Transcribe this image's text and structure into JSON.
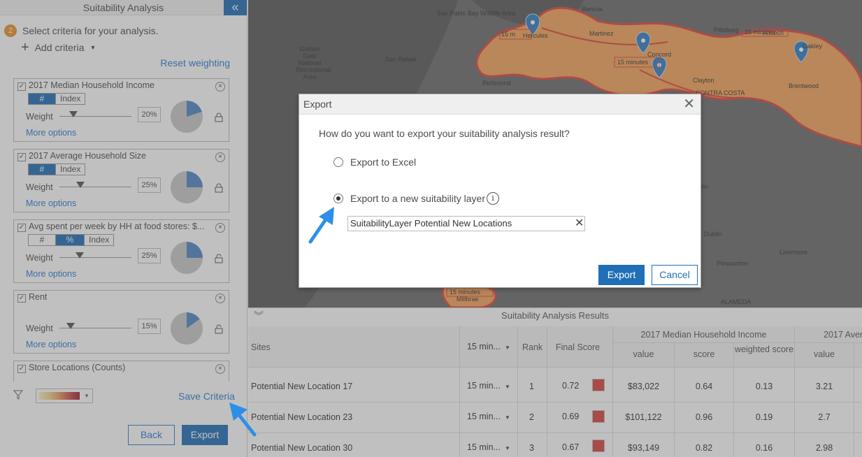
{
  "left_panel": {
    "title": "Suitability Analysis",
    "collapse_glyph": "«",
    "step_number": "2",
    "step_text": "Select criteria for your analysis.",
    "add_criteria": "Add criteria",
    "reset_weighting": "Reset weighting",
    "criteria": [
      {
        "title": "2017 Median Household Income",
        "seg": [
          "#",
          "Index"
        ],
        "active_seg": 0,
        "weight_label": "Weight",
        "weight": "20%",
        "weight_fraction": 0.2,
        "more": "More options",
        "locked": true
      },
      {
        "title": "2017 Average Household Size",
        "seg": [
          "#",
          "Index"
        ],
        "active_seg": 0,
        "weight_label": "Weight",
        "weight": "25%",
        "weight_fraction": 0.25,
        "more": "More options",
        "locked": true
      },
      {
        "title": "Avg spent per week by HH at food stores: $...",
        "seg": [
          "#",
          "%",
          "Index"
        ],
        "active_seg": 1,
        "weight_label": "Weight",
        "weight": "25%",
        "weight_fraction": 0.25,
        "more": "More options",
        "locked": false
      },
      {
        "title": "Rent",
        "seg": [],
        "active_seg": -1,
        "weight_label": "Weight",
        "weight": "15%",
        "weight_fraction": 0.15,
        "more": "More options",
        "locked": false
      },
      {
        "title": "Store Locations (Counts)"
      }
    ],
    "save_criteria": "Save Criteria",
    "back": "Back",
    "export": "Export"
  },
  "map": {
    "places": [
      "San Pablo Bay Wildlife Area",
      "Benicia",
      "Golden Gate National Recreational Area",
      "San Rafael",
      "Hercules",
      "Martinez",
      "Pittsburg",
      "Antioch",
      "Oakley",
      "Concord",
      "Richmond",
      "Clayton",
      "Brentwood",
      "CONTRA COSTA",
      "Dublin",
      "Livermore",
      "Pleasanton",
      "Millbrae",
      "ALAMEDA",
      "on"
    ],
    "time_labels": [
      "15 m",
      "15 minutes",
      "15 minutes",
      "15 minutes"
    ]
  },
  "results": {
    "title": "Suitability Analysis Results",
    "group_headers": [
      "2017 Median Household Income",
      "2017 Aver"
    ],
    "columns": [
      "Sites",
      "15 min...",
      "Rank",
      "Final Score",
      "value",
      "score",
      "weighted score",
      "value"
    ],
    "rows": [
      {
        "site": "Potential New Location 17",
        "time": "15 min...",
        "rank": "1",
        "final": "0.72",
        "value": "$83,022",
        "score": "0.64",
        "weighted": "0.13",
        "value2": "3.21"
      },
      {
        "site": "Potential New Location 23",
        "time": "15 min...",
        "rank": "2",
        "final": "0.69",
        "value": "$101,122",
        "score": "0.96",
        "weighted": "0.19",
        "value2": "2.7"
      },
      {
        "site": "Potential New Location 30",
        "time": "15 min...",
        "rank": "3",
        "final": "0.67",
        "value": "$93,149",
        "score": "0.82",
        "weighted": "0.16",
        "value2": "2.98"
      }
    ]
  },
  "dialog": {
    "title": "Export",
    "question": "How do you want to export your suitability analysis result?",
    "option_excel": "Export to Excel",
    "option_layer": "Export to a new suitability layer",
    "selected": "layer",
    "layer_name": "SuitabilityLayer Potential New Locations",
    "export": "Export",
    "cancel": "Cancel"
  },
  "colors": {
    "accent": "#1f6fb7",
    "link": "#2b7bd1",
    "map_fill": "#f4a35a",
    "map_edge": "#e0453a",
    "marker": "#2f7dc4",
    "score_swatch": "#d7443d"
  }
}
